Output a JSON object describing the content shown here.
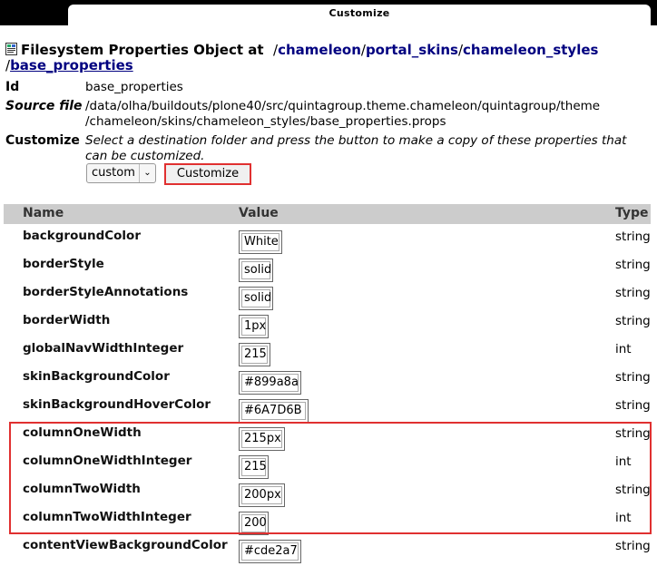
{
  "window": {
    "tab_title": "Customize"
  },
  "heading": {
    "prefix": "Filesystem Properties Object at",
    "path": [
      "chameleon",
      "portal_skins",
      "chameleon_styles",
      "base_properties"
    ]
  },
  "info": {
    "id_label": "Id",
    "id_value": "base_properties",
    "source_label": "Source file",
    "source_line1": "/data/olha/buildouts/plone40/src/quintagroup.theme.chameleon/quintagroup/theme",
    "source_line2": "/chameleon/skins/chameleon_styles/base_properties.props",
    "customize_label": "Customize",
    "customize_help": "Select a destination folder and press the button to make a copy of these properties that can be customized.",
    "folder_select_value": "custom",
    "customize_button": "Customize"
  },
  "table": {
    "headers": {
      "name": "Name",
      "value": "Value",
      "type": "Type"
    },
    "rows": [
      {
        "name": "backgroundColor",
        "value": "White",
        "type": "string"
      },
      {
        "name": "borderStyle",
        "value": "solid",
        "type": "string"
      },
      {
        "name": "borderStyleAnnotations",
        "value": "solid",
        "type": "string"
      },
      {
        "name": "borderWidth",
        "value": "1px",
        "type": "string"
      },
      {
        "name": "globalNavWidthInteger",
        "value": "215",
        "type": "int"
      },
      {
        "name": "skinBackgroundColor",
        "value": "#899a8a",
        "type": "string"
      },
      {
        "name": "skinBackgroundHoverColor",
        "value": "#6A7D6B",
        "type": "string"
      },
      {
        "name": "columnOneWidth",
        "value": "215px",
        "type": "string"
      },
      {
        "name": "columnOneWidthInteger",
        "value": "215",
        "type": "int"
      },
      {
        "name": "columnTwoWidth",
        "value": "200px",
        "type": "string"
      },
      {
        "name": "columnTwoWidthInteger",
        "value": "200",
        "type": "int"
      },
      {
        "name": "contentViewBackgroundColor",
        "value": "#cde2a7",
        "type": "string"
      }
    ]
  },
  "colors": {
    "link": "#000080",
    "highlight": "#e03030",
    "header_bg": "#cccccc"
  }
}
